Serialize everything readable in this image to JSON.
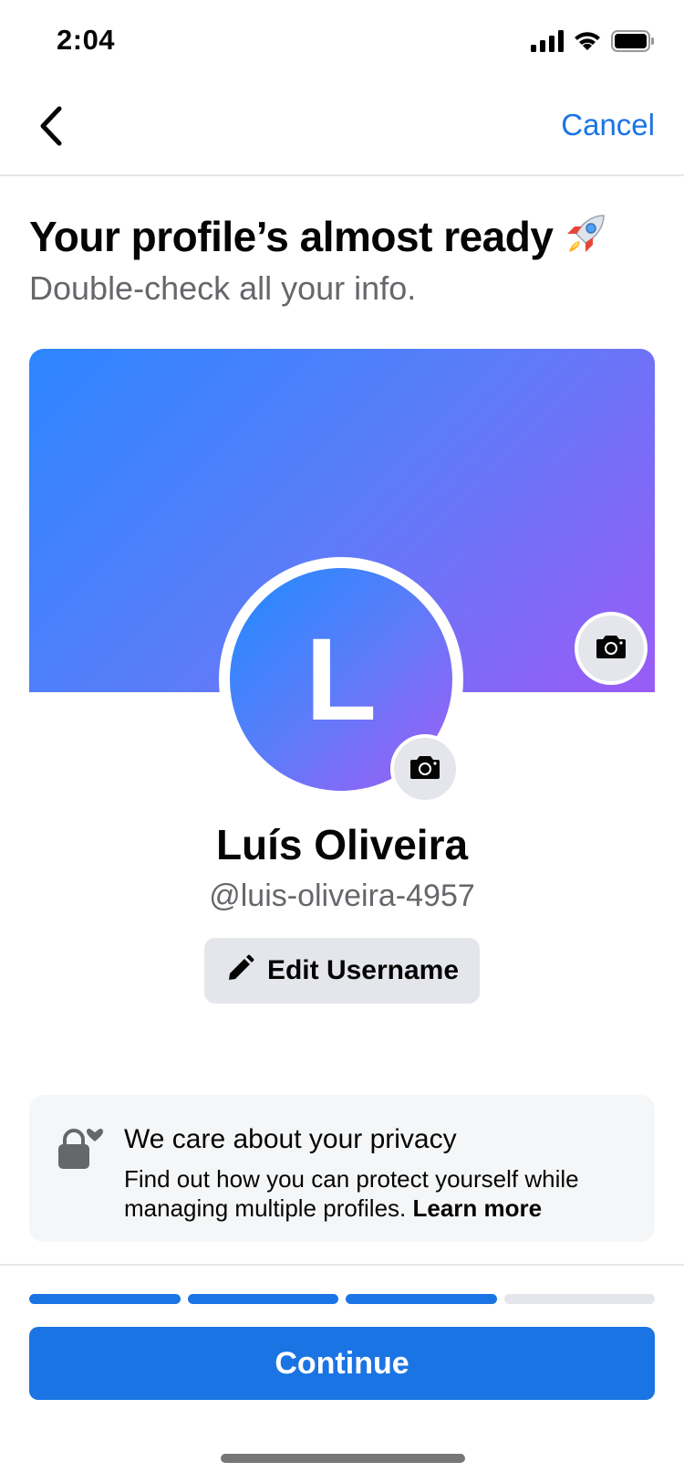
{
  "status_bar": {
    "time": "2:04"
  },
  "nav": {
    "cancel_label": "Cancel"
  },
  "header": {
    "title": "Your profile’s almost ready",
    "title_emoji": "🚀",
    "subtitle": "Double-check all your info."
  },
  "profile": {
    "avatar_initial": "L",
    "name": "Luís Oliveira",
    "username": "@luis-oliveira-4957",
    "edit_username_label": "Edit Username"
  },
  "privacy": {
    "title": "We care about your privacy",
    "text": "Find out how you can protect yourself while managing multiple profiles.",
    "link_label": "Learn more"
  },
  "progress": {
    "completed_steps": 3,
    "total_steps": 4
  },
  "continue_label": "Continue",
  "colors": {
    "accent": "#1b74e4",
    "cover_gradient_start": "#2d86ff",
    "cover_gradient_end": "#9a5cf6"
  },
  "icons": [
    "back-chevron-icon",
    "camera-icon",
    "pencil-icon",
    "lock-heart-icon",
    "signal-icon",
    "wifi-icon",
    "battery-icon"
  ]
}
